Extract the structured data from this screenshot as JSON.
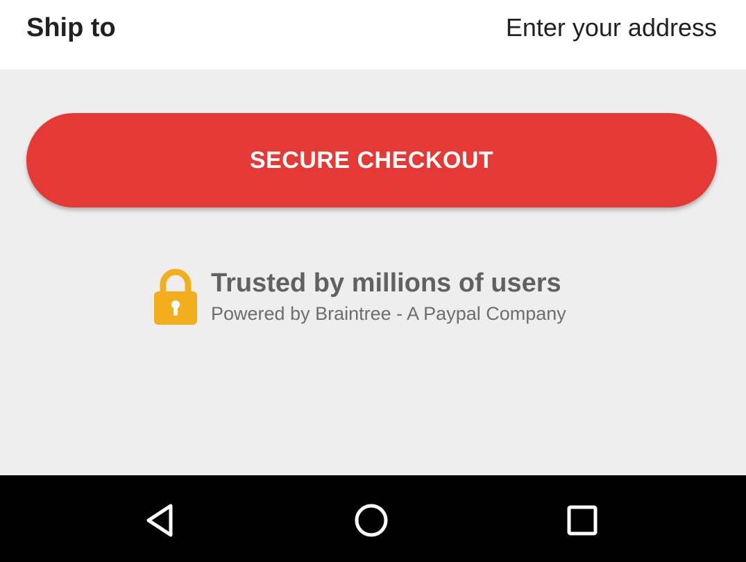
{
  "ship": {
    "label": "Ship to",
    "address_link": "Enter your address"
  },
  "checkout": {
    "button_label": "SECURE CHECKOUT",
    "color": "#e53935"
  },
  "trust": {
    "title": "Trusted by millions of users",
    "subtitle": "Powered by Braintree - A Paypal Company",
    "icon": "lock-icon",
    "icon_color": "#f2ae1c"
  },
  "navbar": {
    "buttons": [
      {
        "icon": "back-icon"
      },
      {
        "icon": "home-icon"
      },
      {
        "icon": "recent-apps-icon"
      }
    ]
  }
}
